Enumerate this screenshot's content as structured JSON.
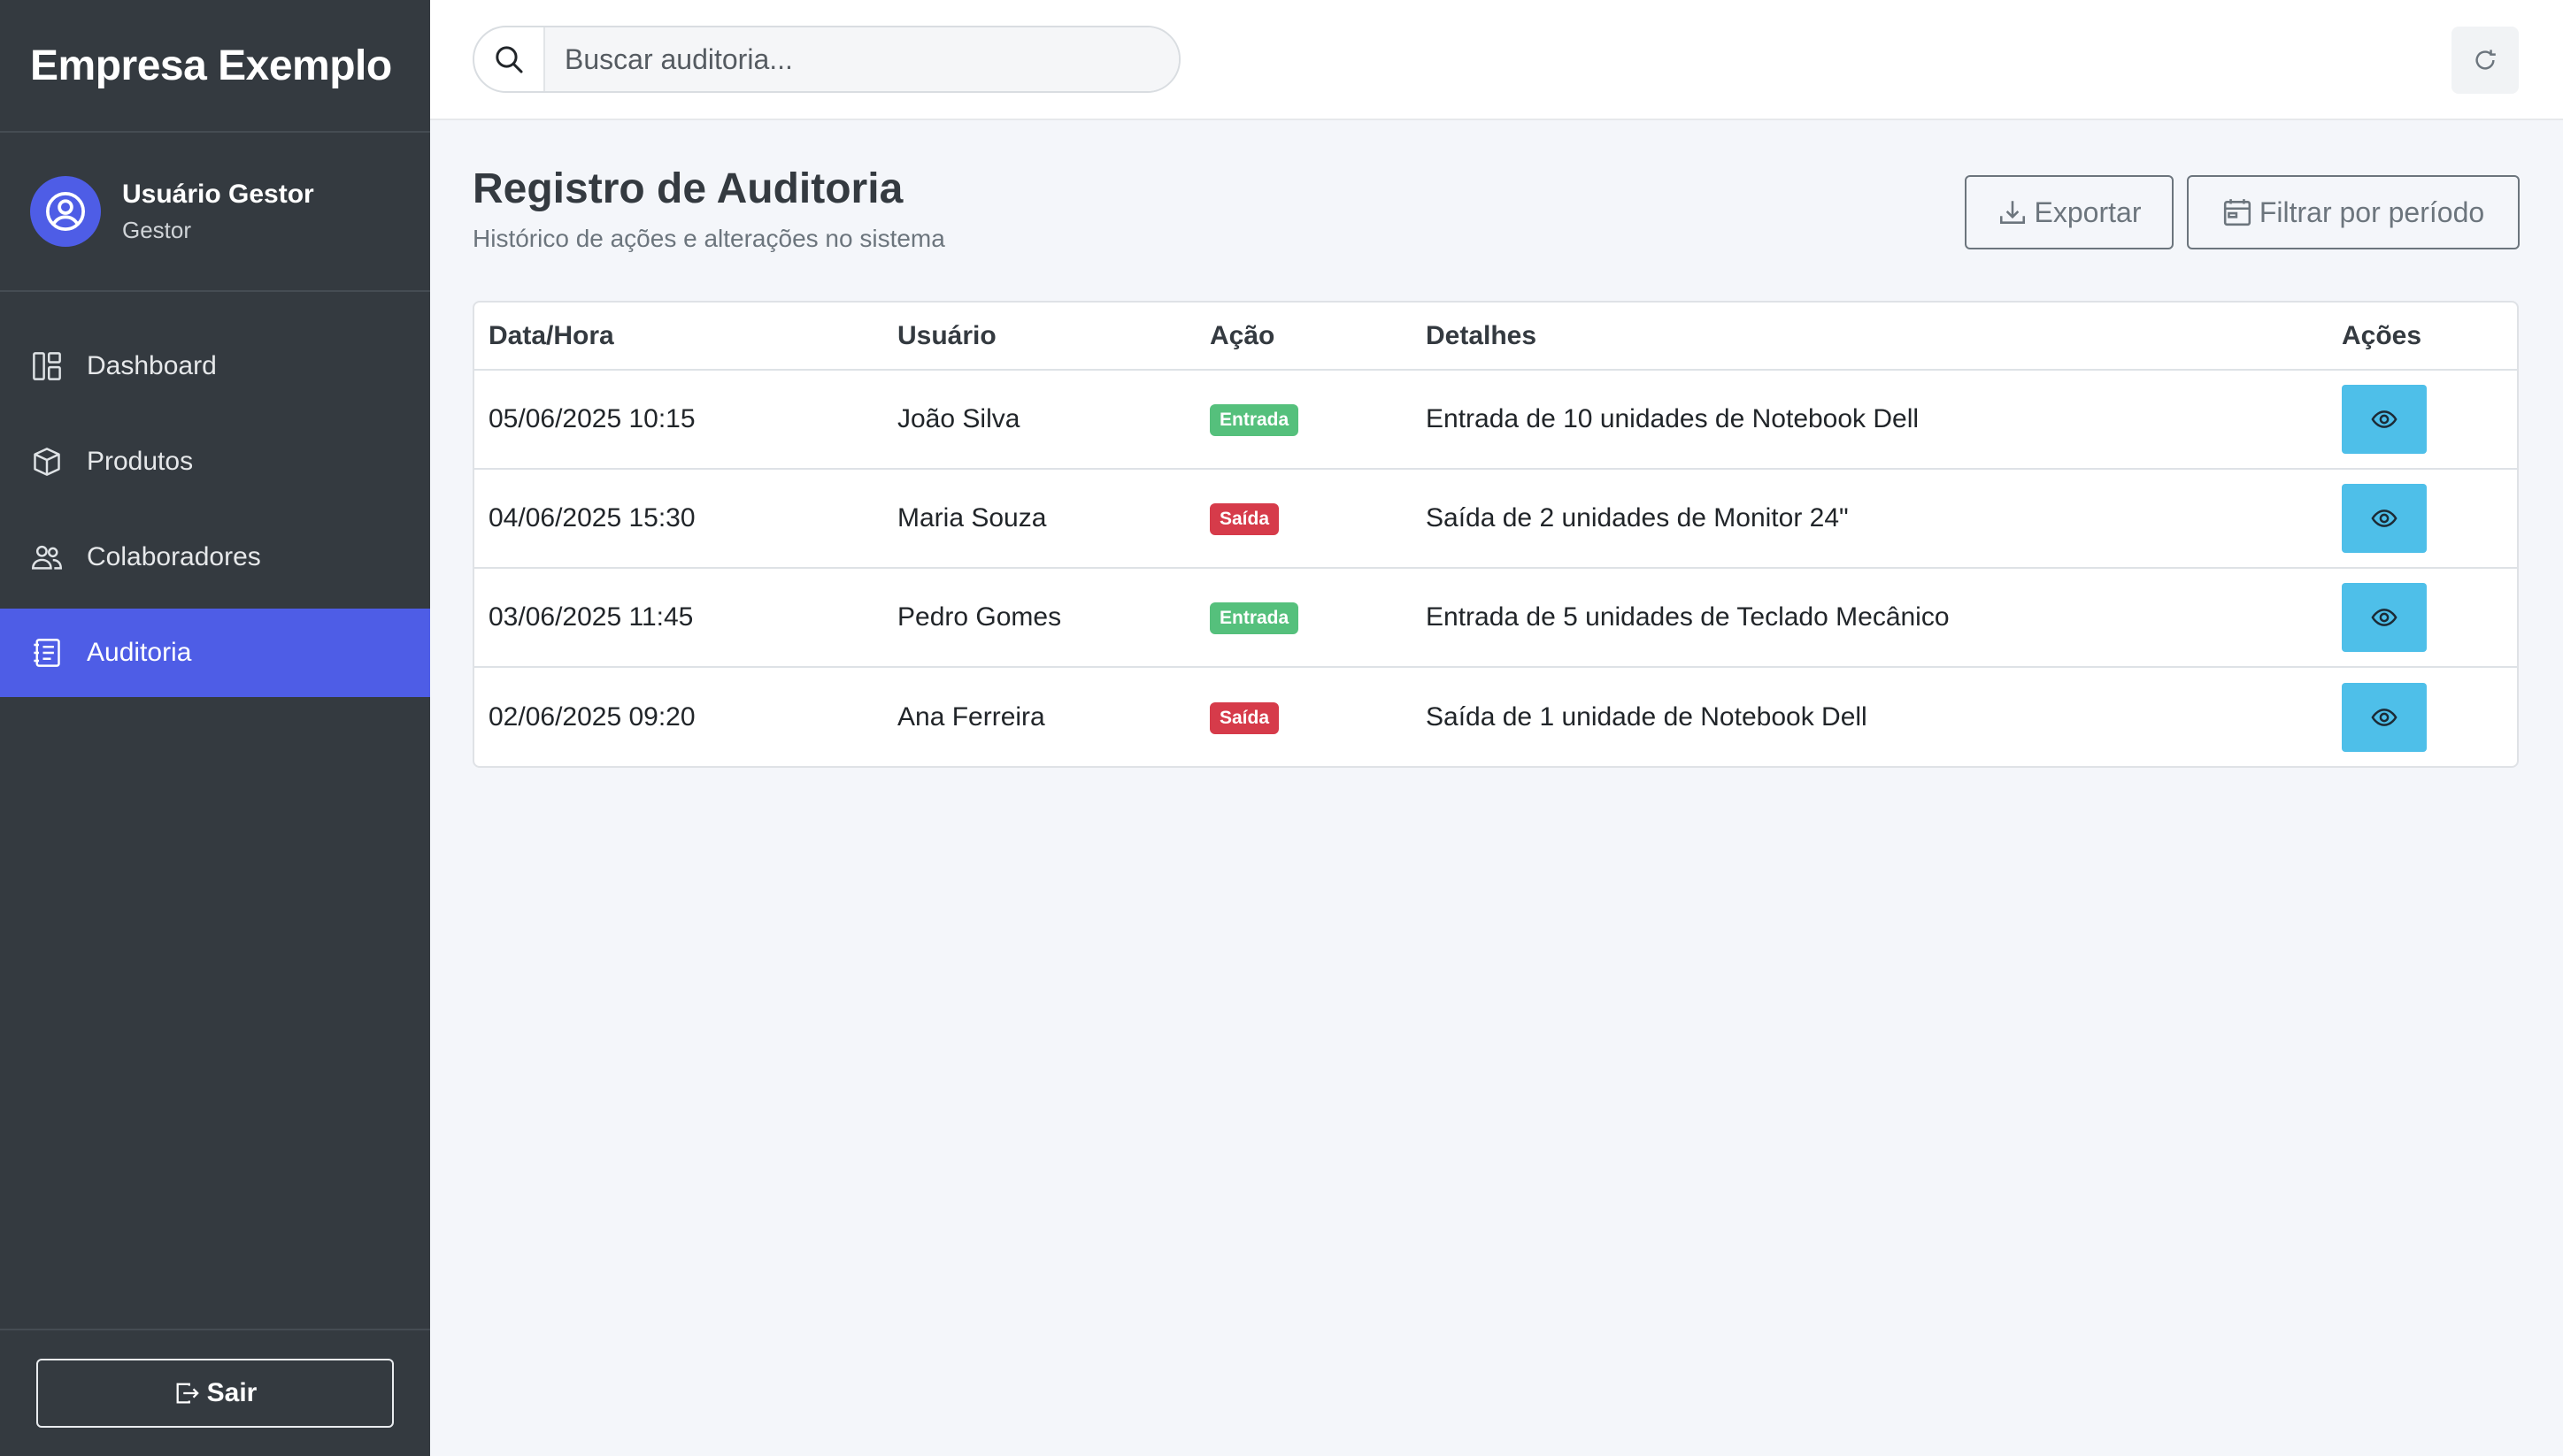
{
  "app": {
    "company": "Empresa Exemplo"
  },
  "user": {
    "name": "Usuário Gestor",
    "role": "Gestor"
  },
  "nav": [
    {
      "label": "Dashboard",
      "icon": "dashboard-icon",
      "active": false
    },
    {
      "label": "Produtos",
      "icon": "box-icon",
      "active": false
    },
    {
      "label": "Colaboradores",
      "icon": "people-icon",
      "active": false
    },
    {
      "label": "Auditoria",
      "icon": "journal-icon",
      "active": true
    }
  ],
  "logout_label": "Sair",
  "search": {
    "placeholder": "Buscar auditoria...",
    "value": ""
  },
  "page": {
    "title": "Registro de Auditoria",
    "subtitle": "Histórico de ações e alterações no sistema",
    "export_label": "Exportar",
    "filter_label": "Filtrar por período"
  },
  "table": {
    "columns": [
      "Data/Hora",
      "Usuário",
      "Ação",
      "Detalhes",
      "Ações"
    ],
    "rows": [
      {
        "datetime": "05/06/2025 10:15",
        "user": "João Silva",
        "action": "Entrada",
        "action_type": "in",
        "details": "Entrada de 10 unidades de Notebook Dell"
      },
      {
        "datetime": "04/06/2025 15:30",
        "user": "Maria Souza",
        "action": "Saída",
        "action_type": "out",
        "details": "Saída de 2 unidades de Monitor 24\""
      },
      {
        "datetime": "03/06/2025 11:45",
        "user": "Pedro Gomes",
        "action": "Entrada",
        "action_type": "in",
        "details": "Entrada de 5 unidades de Teclado Mecânico"
      },
      {
        "datetime": "02/06/2025 09:20",
        "user": "Ana Ferreira",
        "action": "Saída",
        "action_type": "out",
        "details": "Saída de 1 unidade de Notebook Dell"
      }
    ]
  },
  "colors": {
    "sidebar": "#343a40",
    "accent": "#4e5de6",
    "badge_in": "#55c07c",
    "badge_out": "#d63b4a",
    "view_button": "#4ebfe9"
  }
}
